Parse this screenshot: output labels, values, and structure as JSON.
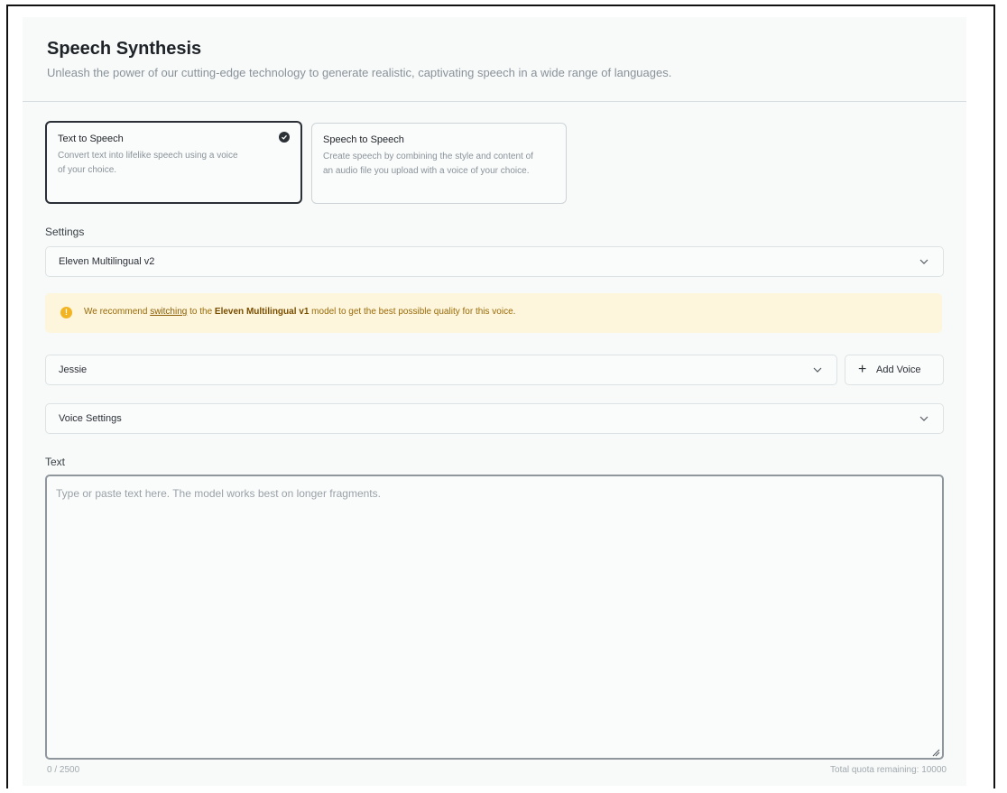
{
  "header": {
    "title": "Speech Synthesis",
    "subtitle": "Unleash the power of our cutting-edge technology to generate realistic, captivating speech in a wide range of languages."
  },
  "modes": [
    {
      "title": "Text to Speech",
      "description": "Convert text into lifelike speech using a voice of your choice.",
      "selected": true
    },
    {
      "title": "Speech to Speech",
      "description": "Create speech by combining the style and content of an audio file you upload with a voice of your choice.",
      "selected": false
    }
  ],
  "settings": {
    "label": "Settings",
    "model_value": "Eleven Multilingual v2"
  },
  "warning": {
    "prefix": "We recommend",
    "link_text": "switching",
    "middle": "to the",
    "model_name": "Eleven Multilingual v1",
    "suffix": "model to get the best possible quality for this voice.",
    "icon": "exclamation-icon",
    "color": "#f2b422"
  },
  "voice": {
    "selected": "Jessie",
    "add_label": "Add Voice"
  },
  "voice_settings": {
    "label": "Voice Settings"
  },
  "text": {
    "label": "Text",
    "placeholder": "Type or paste text here. The model works best on longer fragments.",
    "counter": "0 / 2500",
    "quota": "Total quota remaining: 10000"
  }
}
